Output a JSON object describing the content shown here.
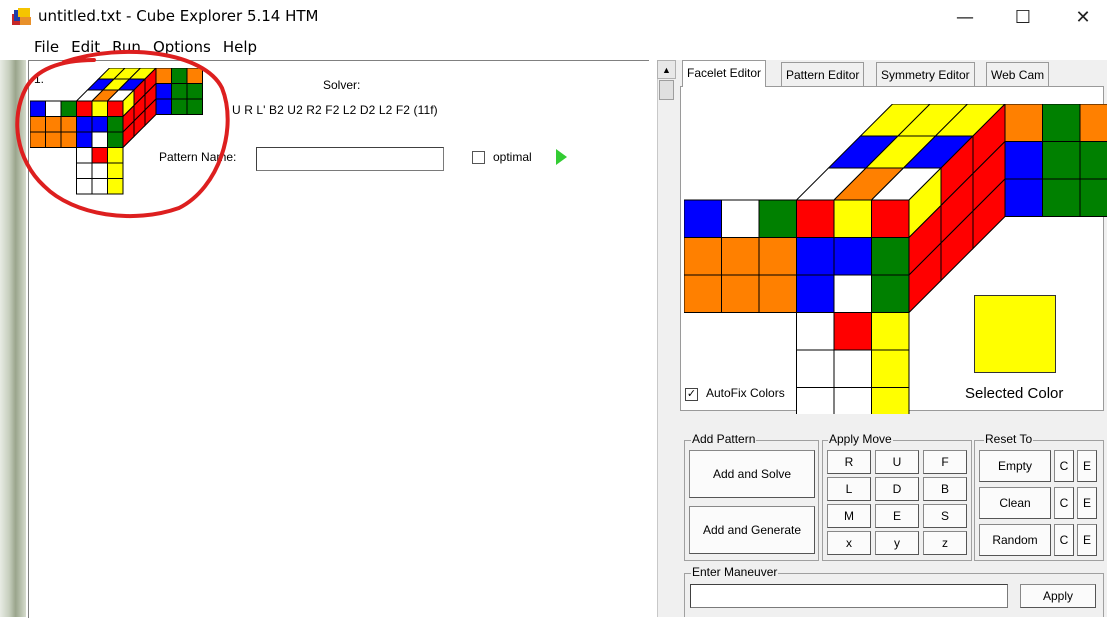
{
  "window": {
    "title": "untitled.txt - Cube Explorer 5.14 HTM",
    "minimize": "—",
    "maximize": "☐",
    "close": "✕"
  },
  "menu": [
    "File",
    "Edit",
    "Run",
    "Options",
    "Help"
  ],
  "document": {
    "entry_number": "1.",
    "solver_label": "Solver:",
    "solver_moves": "U R L' B2 U2 R2 F2 L2 D2 L2 F2  (11f)",
    "pattern_name_label": "Pattern Name:",
    "pattern_name_value": "",
    "optimal_label": "optimal",
    "optimal_checked": false
  },
  "tabs": [
    "Facelet Editor",
    "Pattern Editor",
    "Symmetry Editor",
    "Web Cam"
  ],
  "active_tab": "Facelet Editor",
  "facelet_editor": {
    "autofix_label": "AutoFix Colors",
    "autofix_checked": true,
    "selected_color_label": "Selected Color",
    "selected_color": "#ffff00"
  },
  "add_pattern": {
    "title": "Add Pattern",
    "add_and_solve": "Add and Solve",
    "add_and_generate": "Add and Generate"
  },
  "apply_move": {
    "title": "Apply Move",
    "buttons": [
      "R",
      "U",
      "F",
      "L",
      "D",
      "B",
      "M",
      "E",
      "S",
      "x",
      "y",
      "z"
    ]
  },
  "reset_to": {
    "title": "Reset To",
    "rows": [
      {
        "label": "Empty",
        "c": "C",
        "e": "E"
      },
      {
        "label": "Clean",
        "c": "C",
        "e": "E"
      },
      {
        "label": "Random",
        "c": "C",
        "e": "E"
      }
    ]
  },
  "enter_maneuver": {
    "title": "Enter Maneuver",
    "value": "",
    "apply_label": "Apply"
  },
  "colors": {
    "yellow": "#ffff00",
    "red": "#ff0000",
    "blue": "#0000ff",
    "green": "#008000",
    "orange": "#ff8000",
    "white": "#ffffff",
    "annotation": "#dd1f1f"
  },
  "cube_facelets": {
    "U": [
      "Y",
      "Y",
      "Y",
      "B",
      "Y",
      "B",
      "W",
      "O",
      "W"
    ],
    "R": [
      "Y",
      "R",
      "R",
      "R",
      "R",
      "R",
      "R",
      "R",
      "R"
    ],
    "F": [
      "R",
      "Y",
      "R",
      "B",
      "B",
      "G",
      "B",
      "W",
      "G"
    ],
    "L": [
      "B",
      "W",
      "G",
      "O",
      "O",
      "O",
      "O",
      "O",
      "O"
    ],
    "D": [
      "W",
      "R",
      "Y",
      "W",
      "W",
      "Y",
      "W",
      "W",
      "Y"
    ],
    "B": [
      "O",
      "G",
      "O",
      "B",
      "G",
      "G",
      "B",
      "G",
      "G"
    ]
  }
}
